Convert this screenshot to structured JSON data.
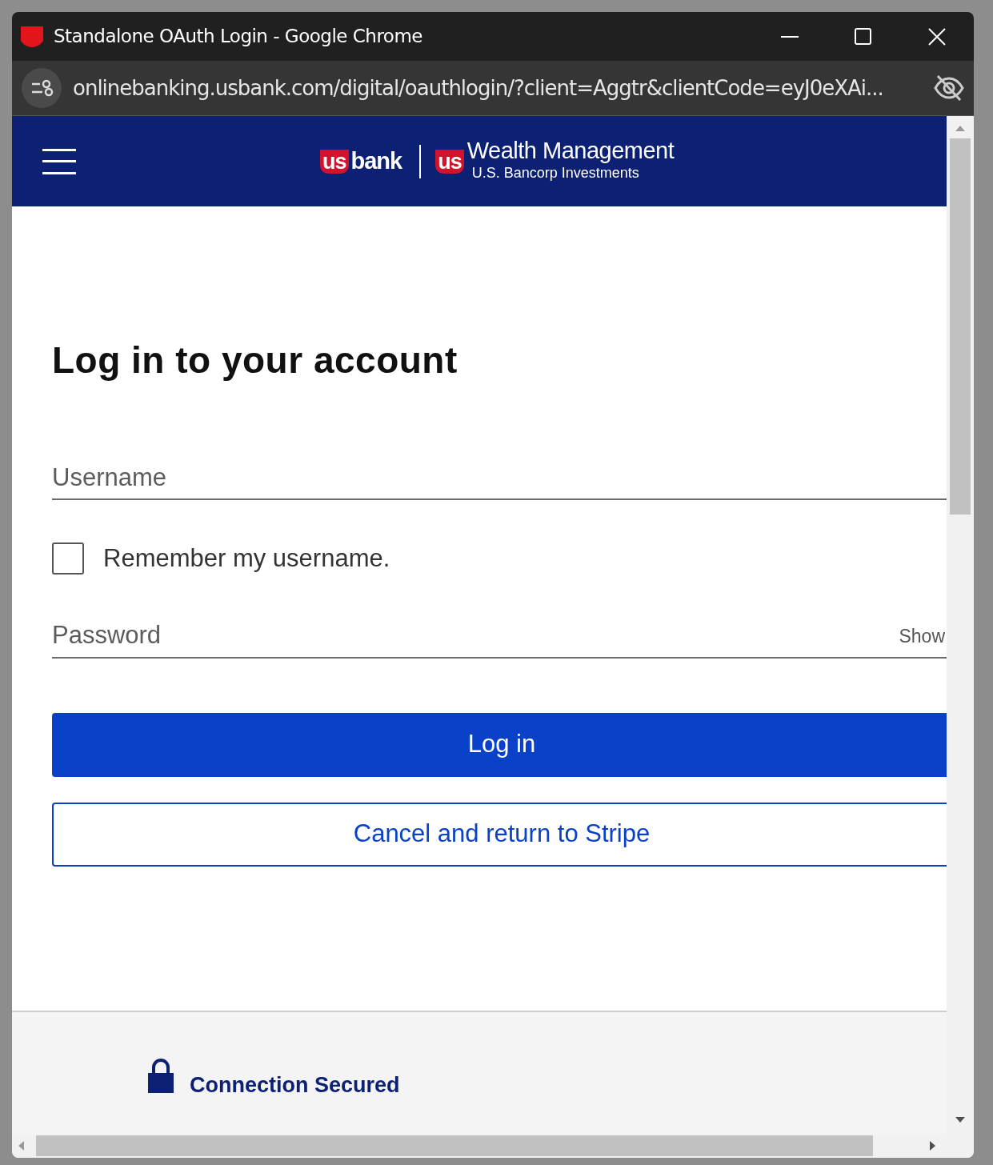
{
  "window": {
    "title": "Standalone OAuth Login - Google Chrome",
    "url": "onlinebanking.usbank.com/digital/oauthlogin/?client=Aggtr&clientCode=eyJ0eXAi..."
  },
  "header": {
    "logo_mark": "us",
    "logo_word": "bank",
    "brand_mark": "us",
    "brand_name": "Wealth Management",
    "brand_sub": "U.S. Bancorp Investments"
  },
  "form": {
    "heading": "Log in to your account",
    "username": {
      "placeholder": "Username"
    },
    "remember": {
      "label": "Remember my username.",
      "checked": false
    },
    "password": {
      "placeholder": "Password",
      "toggle": "Show"
    },
    "buttons": [
      {
        "kind": "primary",
        "label": "Log in"
      },
      {
        "kind": "outline",
        "label": "Cancel and return to Stripe"
      }
    ]
  },
  "footer": {
    "secure_label": "Connection Secured"
  }
}
